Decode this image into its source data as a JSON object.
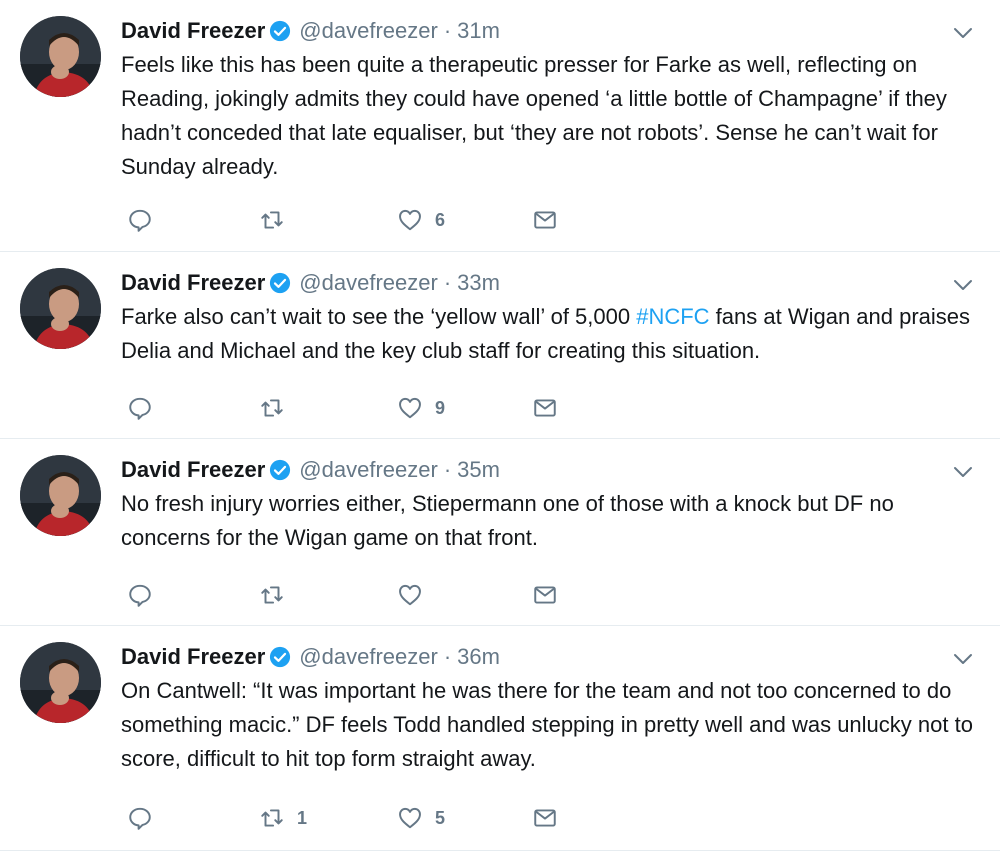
{
  "tweets": [
    {
      "name": "David Freezer",
      "handle": "@davefreezer",
      "dot": "·",
      "time": "31m",
      "text_before": "Feels like this has been quite a therapeutic presser for Farke as well, reflecting on Reading, jokingly admits they could have opened ‘a little bottle of Champagne’ if they hadn’t conceded that late equaliser, but ‘they are not robots’. Sense he can’t wait for Sunday already.",
      "hashtag": "",
      "text_after": "",
      "reply_count": "",
      "retweet_count": "",
      "like_count": "6"
    },
    {
      "name": "David Freezer",
      "handle": "@davefreezer",
      "dot": "·",
      "time": "33m",
      "text_before": "Farke also can’t wait to see the ‘yellow wall’ of 5,000 ",
      "hashtag": "#NCFC",
      "text_after": " fans at Wigan and praises Delia and Michael and the key club staff for creating this situation.",
      "reply_count": "",
      "retweet_count": "",
      "like_count": "9"
    },
    {
      "name": "David Freezer",
      "handle": "@davefreezer",
      "dot": "·",
      "time": "35m",
      "text_before": "No fresh injury worries either, Stiepermann one of those with a knock but DF no concerns for the Wigan game on that front.",
      "hashtag": "",
      "text_after": "",
      "reply_count": "",
      "retweet_count": "",
      "like_count": ""
    },
    {
      "name": "David Freezer",
      "handle": "@davefreezer",
      "dot": "·",
      "time": "36m",
      "text_before": "On Cantwell: “It was important he was there for the team and not too concerned to do something macic.” DF feels Todd handled stepping in pretty well and was unlucky not to score, difficult to hit top form straight away.",
      "hashtag": "",
      "text_after": "",
      "reply_count": "",
      "retweet_count": "1",
      "like_count": "5"
    }
  ],
  "icons": {
    "verified": "verified-badge-icon",
    "caret": "chevron-down-icon",
    "reply": "reply-icon",
    "retweet": "retweet-icon",
    "like": "heart-icon",
    "dm": "envelope-icon"
  },
  "colors": {
    "text": "#14171a",
    "secondary": "#657786",
    "link": "#1da1f2",
    "verified": "#1da1f2",
    "divider": "#e6ecf0"
  }
}
